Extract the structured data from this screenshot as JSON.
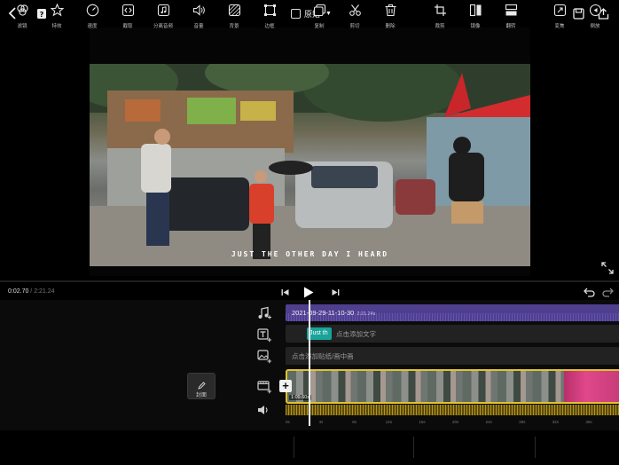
{
  "header": {
    "ratio_label": "原始"
  },
  "preview": {
    "subtitle": "JUST THE OTHER DAY I HEARD"
  },
  "playback": {
    "current_time": "0:02.70",
    "separator": " / ",
    "total_time": "2:21.24"
  },
  "tracks": {
    "music": {
      "name": "2021-09-29-11-10-30",
      "duration": "2:21.24s"
    },
    "text": {
      "chip": "Just th",
      "add_label": "点击添加文字"
    },
    "sticker": {
      "add_label": "点击添加贴纸/画中画"
    },
    "cover_label": "封面",
    "video": {
      "clip_duration": "1:09.60s"
    },
    "ruler": [
      "0s",
      "4s",
      "8s",
      "12s",
      "16s",
      "20s",
      "24s",
      "28s",
      "32s",
      "36s"
    ]
  },
  "toolbar": {
    "items": [
      {
        "icon": "filter-icon",
        "label": "滤镜"
      },
      {
        "icon": "effects-icon",
        "label": "特效"
      },
      {
        "icon": "speed-icon",
        "label": "速度"
      },
      {
        "icon": "trim-icon",
        "label": "截取"
      },
      {
        "icon": "separate-audio-icon",
        "label": "分离音频"
      },
      {
        "icon": "volume-icon",
        "label": "音量"
      },
      {
        "icon": "background-icon",
        "label": "背景"
      },
      {
        "icon": "border-icon",
        "label": "边框"
      },
      {
        "icon": "copy-icon",
        "label": "复制"
      },
      {
        "icon": "cut-icon",
        "label": "剪切"
      },
      {
        "icon": "delete-icon",
        "label": "删除"
      },
      {
        "icon": "crop-icon",
        "label": "裁剪"
      },
      {
        "icon": "mirror-icon",
        "label": "镜像"
      },
      {
        "icon": "flip-icon",
        "label": "翻转"
      },
      {
        "icon": "transform-icon",
        "label": "变焦"
      },
      {
        "icon": "reverse-icon",
        "label": "倒放"
      }
    ]
  },
  "colors": {
    "music_track": "#4f3f8f",
    "text_chip": "#1aa39a",
    "video_border": "#e0c32e"
  }
}
